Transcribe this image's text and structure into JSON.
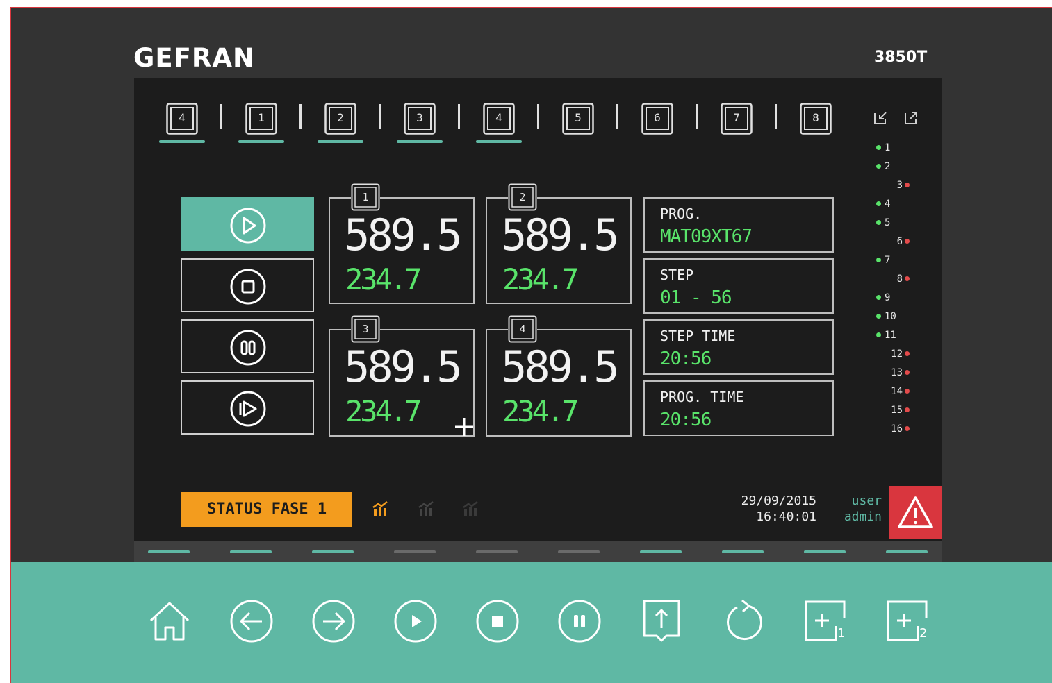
{
  "header": {
    "brand": "GEFRAN",
    "model": "3850T"
  },
  "tabs": [
    {
      "label": "4",
      "underlined": true
    },
    {
      "label": "1",
      "underlined": true
    },
    {
      "label": "2",
      "underlined": true
    },
    {
      "label": "3",
      "underlined": true
    },
    {
      "label": "4",
      "underlined": true
    },
    {
      "label": "5",
      "underlined": false
    },
    {
      "label": "6",
      "underlined": false
    },
    {
      "label": "7",
      "underlined": false
    },
    {
      "label": "8",
      "underlined": false
    }
  ],
  "corner_icons": [
    "collapse-icon",
    "expand-icon"
  ],
  "controls": [
    {
      "name": "play",
      "icon": "play-icon",
      "active": true
    },
    {
      "name": "stop",
      "icon": "stop-icon",
      "active": false
    },
    {
      "name": "pause",
      "icon": "pause-icon",
      "active": false
    },
    {
      "name": "skip",
      "icon": "skip-forward-icon",
      "active": false
    }
  ],
  "zones": [
    {
      "label": "1",
      "value": "589.5",
      "setpoint": "234.7"
    },
    {
      "label": "2",
      "value": "589.5",
      "setpoint": "234.7"
    },
    {
      "label": "3",
      "value": "589.5",
      "setpoint": "234.7"
    },
    {
      "label": "4",
      "value": "589.5",
      "setpoint": "234.7"
    }
  ],
  "info": [
    {
      "label": "PROG.",
      "value": "MAT09XT67"
    },
    {
      "label": "STEP",
      "value": "01 - 56"
    },
    {
      "label": "STEP TIME",
      "value": "20:56"
    },
    {
      "label": "PROG. TIME",
      "value": "20:56"
    }
  ],
  "leds": [
    {
      "n": "1",
      "state": "green"
    },
    {
      "n": "2",
      "state": "green"
    },
    {
      "n": "3",
      "state": "red"
    },
    {
      "n": "4",
      "state": "green"
    },
    {
      "n": "5",
      "state": "green"
    },
    {
      "n": "6",
      "state": "red"
    },
    {
      "n": "7",
      "state": "green"
    },
    {
      "n": "8",
      "state": "red"
    },
    {
      "n": "9",
      "state": "green"
    },
    {
      "n": "10",
      "state": "green"
    },
    {
      "n": "11",
      "state": "green"
    },
    {
      "n": "12",
      "state": "red"
    },
    {
      "n": "13",
      "state": "red"
    },
    {
      "n": "14",
      "state": "red"
    },
    {
      "n": "15",
      "state": "red"
    },
    {
      "n": "16",
      "state": "red"
    }
  ],
  "status": {
    "label": "STATUS FASE 1"
  },
  "phase_icons": [
    {
      "name": "phase-chart-icon",
      "active": true
    },
    {
      "name": "phase-chart-icon",
      "active": false
    },
    {
      "name": "phase-chart-icon",
      "active": false
    }
  ],
  "footer_info": {
    "date": "29/09/2015",
    "time": "16:40:01",
    "user": "user",
    "role": "admin"
  },
  "alarm_icon": "warning-icon",
  "pages": [
    true,
    true,
    true,
    false,
    false,
    false,
    true,
    true,
    true,
    true
  ],
  "footer_buttons": [
    {
      "icon": "home-icon"
    },
    {
      "icon": "arrow-left-icon"
    },
    {
      "icon": "arrow-right-icon"
    },
    {
      "icon": "play-circle-icon"
    },
    {
      "icon": "stop-circle-icon"
    },
    {
      "icon": "pause-circle-icon"
    },
    {
      "icon": "upload-icon"
    },
    {
      "icon": "refresh-icon"
    },
    {
      "icon": "add-icon",
      "sub": "1"
    },
    {
      "icon": "add-icon",
      "sub": "2"
    }
  ],
  "colors": {
    "teal": "#5fb8a4",
    "green": "#59e36a",
    "orange": "#f39c1e",
    "red": "#d9363e",
    "panel": "#1c1c1c",
    "bezel": "#333333"
  }
}
